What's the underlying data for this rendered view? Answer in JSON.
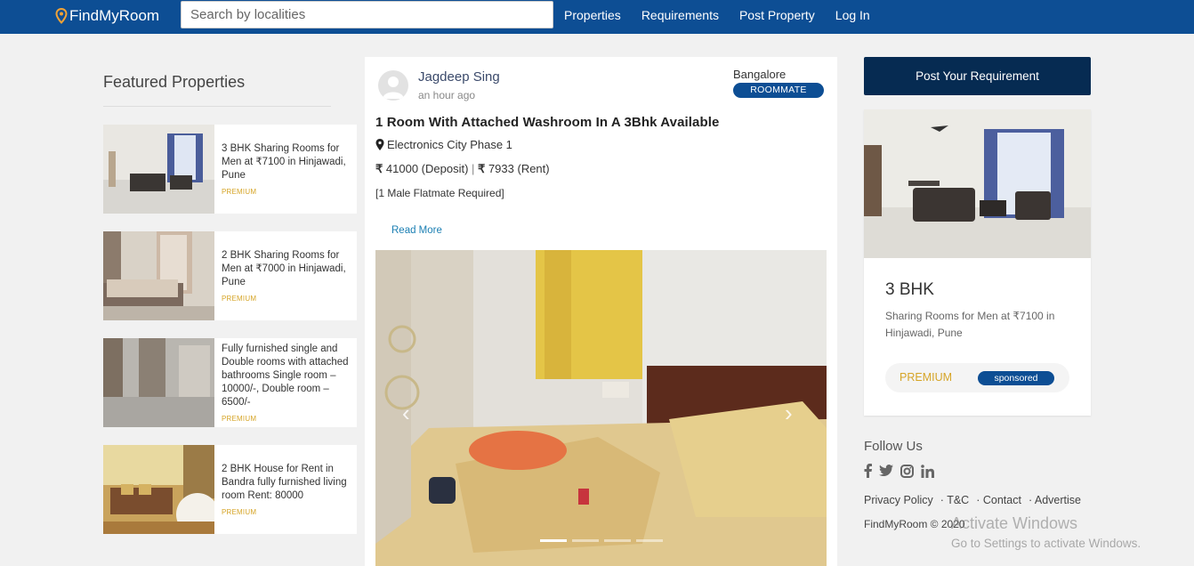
{
  "nav": {
    "brand": "FindMyRoom",
    "search_placeholder": "Search by localities",
    "links": [
      "Properties",
      "Requirements",
      "Post Property",
      "Log In"
    ]
  },
  "featured": {
    "heading": "Featured Properties",
    "items": [
      {
        "desc": "3 BHK Sharing Rooms for Men at ₹7100 in Hinjawadi, Pune",
        "badge": "PREMIUM"
      },
      {
        "desc": "2 BHK Sharing Rooms for Men at ₹7000 in Hinjawadi, Pune",
        "badge": "PREMIUM"
      },
      {
        "desc": "Fully furnished single and Double rooms with attached bathrooms Single room – 10000/-, Double room – 6500/-",
        "badge": "PREMIUM"
      },
      {
        "desc": "2 BHK House for Rent in Bandra fully furnished living room Rent: 80000",
        "badge": "PREMIUM"
      }
    ]
  },
  "post": {
    "author": "Jagdeep Sing",
    "time": "an hour ago",
    "city": "Bangalore",
    "tag": "ROOMMATE",
    "title": "1 Room With Attached Washroom In A 3Bhk Available",
    "location": "Electronics City Phase 1",
    "deposit": "41000 (Deposit)",
    "rent": "7933 (Rent)",
    "requirement": "[1 Male Flatmate Required]",
    "read_more": "Read More",
    "slide_count": 4,
    "active_slide": 1
  },
  "sidebar": {
    "post_req_button": "Post Your Requirement",
    "card": {
      "title": "3 BHK",
      "desc": "Sharing Rooms for Men at ₹7100 in Hinjawadi, Pune",
      "premium": "PREMIUM",
      "sponsored": "sponsored"
    },
    "follow_heading": "Follow Us",
    "social_icons": [
      "facebook-icon",
      "twitter-icon",
      "instagram-icon",
      "linkedin-icon"
    ],
    "footer_links": [
      "Privacy Policy",
      "· T&C",
      "· Contact",
      "· Advertise"
    ],
    "copyright": "FindMyRoom © 2020"
  },
  "watermark": {
    "line1": "Activate Windows",
    "line2": "Go to Settings to activate Windows."
  },
  "colors": {
    "nav_bg": "#0d4e94",
    "dark_button": "#062b52",
    "premium": "#d6a528",
    "link": "#1b7fb3"
  }
}
